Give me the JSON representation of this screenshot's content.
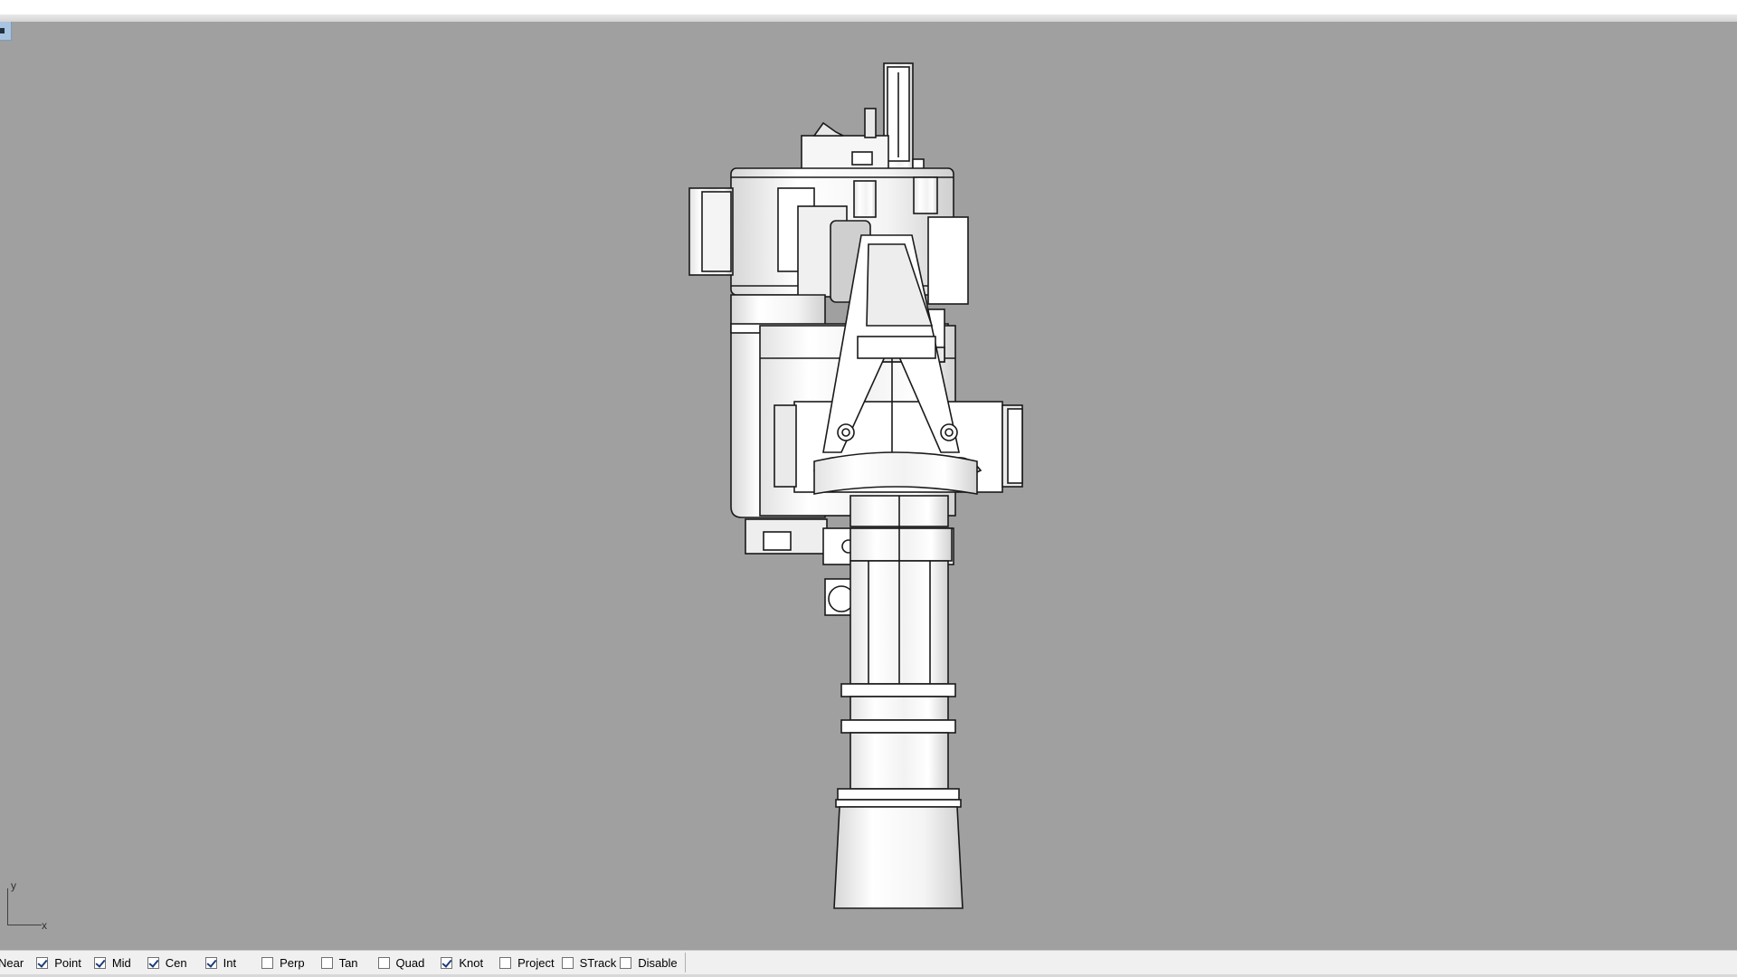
{
  "viewport": {
    "background": "#a0a0a0",
    "axis": {
      "x_label": "x",
      "y_label": "y"
    }
  },
  "osnap": {
    "items": [
      {
        "label": "Near",
        "checked": null
      },
      {
        "label": "Point",
        "checked": true
      },
      {
        "label": "Mid",
        "checked": true
      },
      {
        "label": "Cen",
        "checked": true
      },
      {
        "label": "Int",
        "checked": true
      },
      {
        "label": "Perp",
        "checked": false
      },
      {
        "label": "Tan",
        "checked": false
      },
      {
        "label": "Quad",
        "checked": false
      },
      {
        "label": "Knot",
        "checked": true
      },
      {
        "label": "Project",
        "checked": false
      },
      {
        "label": "STrack",
        "checked": false
      },
      {
        "label": "Disable",
        "checked": false
      }
    ]
  },
  "colors": {
    "model_fill": "#ffffff",
    "model_shade": "#d8d8d8",
    "model_stroke": "#1a1a1a",
    "checkbox_check": "#1c3c7c"
  }
}
